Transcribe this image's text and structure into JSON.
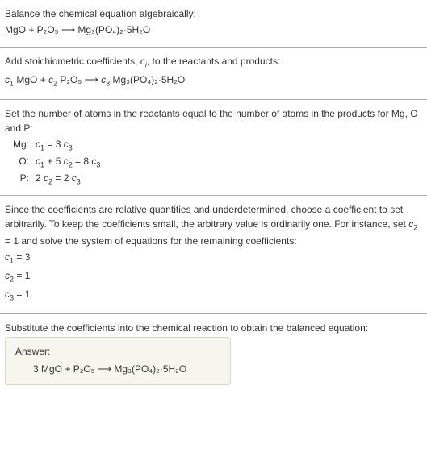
{
  "s1": {
    "line1": "Balance the chemical equation algebraically:",
    "line2": "MgO + P₂O₅ ⟶ Mg₃(PO₄)₂·5H₂O"
  },
  "s2": {
    "line1_a": "Add stoichiometric coefficients, ",
    "line1_b": "c",
    "line1_c": "i",
    "line1_d": ", to the reactants and products:",
    "line2_a": "c",
    "line2_b": "1",
    "line2_c": " MgO + ",
    "line2_d": "c",
    "line2_e": "2",
    "line2_f": " P₂O₅ ⟶ ",
    "line2_g": "c",
    "line2_h": "3",
    "line2_i": " Mg₃(PO₄)₂·5H₂O"
  },
  "s3": {
    "intro": "Set the number of atoms in the reactants equal to the number of atoms in the products for Mg, O and P:",
    "rows": [
      {
        "lab": "Mg:",
        "a1": "c",
        "a2": "1",
        "a3": " = 3 ",
        "a4": "c",
        "a5": "3"
      },
      {
        "lab": "O:",
        "a1": "c",
        "a2": "1",
        "a3": " + 5 ",
        "b1": "c",
        "b2": "2",
        "b3": " = 8 ",
        "c1": "c",
        "c2": "3"
      },
      {
        "lab": "P:",
        "a1": "2 ",
        "a2": "c",
        "a3": "2",
        "a4": " = 2 ",
        "a5": "c",
        "a6": "3"
      }
    ]
  },
  "s4": {
    "intro_a": "Since the coefficients are relative quantities and underdetermined, choose a coefficient to set arbitrarily. To keep the coefficients small, the arbitrary value is ordinarily one. For instance, set ",
    "intro_b": "c",
    "intro_c": "2",
    "intro_d": " = 1 and solve the system of equations for the remaining coefficients:",
    "eq1_a": "c",
    "eq1_b": "1",
    "eq1_c": " = 3",
    "eq2_a": "c",
    "eq2_b": "2",
    "eq2_c": " = 1",
    "eq3_a": "c",
    "eq3_b": "3",
    "eq3_c": " = 1"
  },
  "s5": {
    "intro": "Substitute the coefficients into the chemical reaction to obtain the balanced equation:",
    "answer_label": "Answer:",
    "answer_body": "3 MgO + P₂O₅ ⟶ Mg₃(PO₄)₂·5H₂O"
  }
}
